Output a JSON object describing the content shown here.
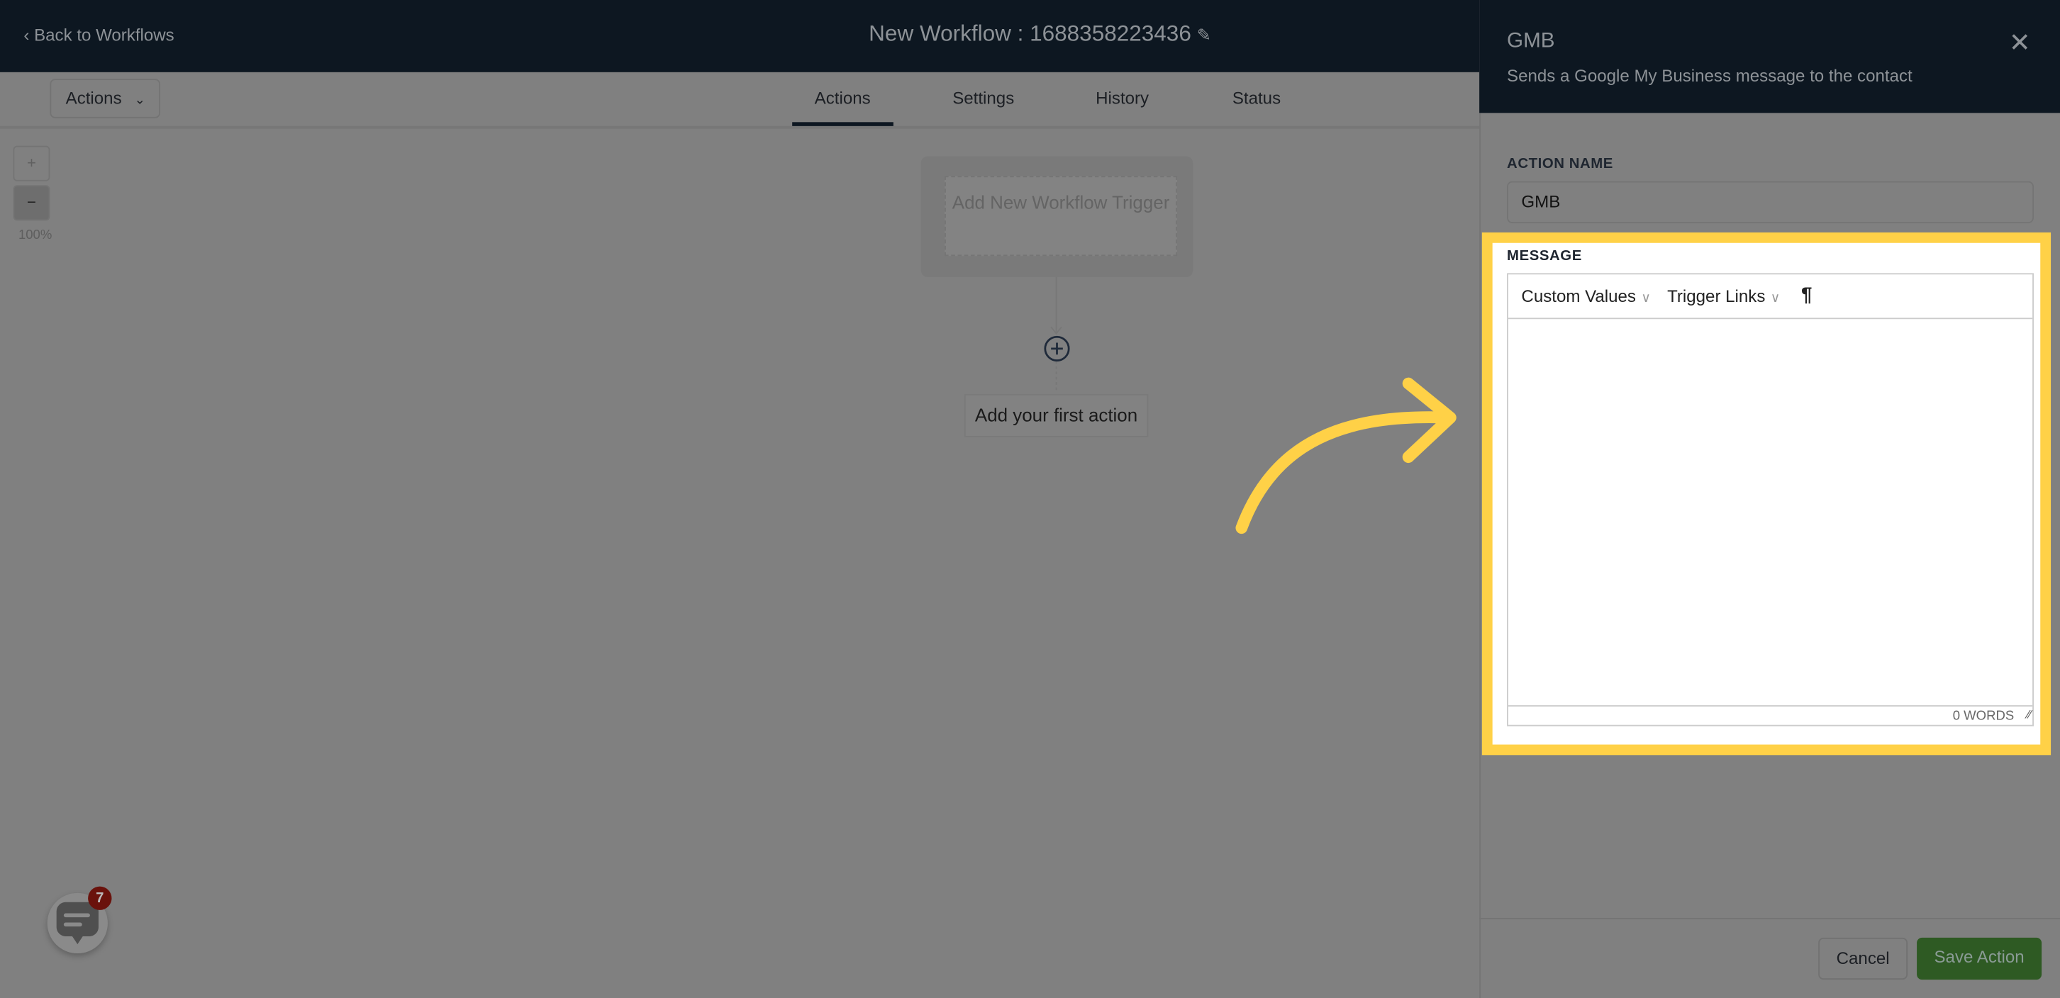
{
  "header": {
    "back_label": "Back to Workflows",
    "title": "New Workflow : 1688358223436",
    "edit_icon": "pencil-icon"
  },
  "toolbar": {
    "actions_dropdown": "Actions"
  },
  "tabs": [
    {
      "label": "Actions",
      "active": true
    },
    {
      "label": "Settings"
    },
    {
      "label": "History"
    },
    {
      "label": "Status"
    }
  ],
  "zoom": {
    "plus": "+",
    "minus": "−",
    "level": "100%"
  },
  "canvas": {
    "trigger_label": "Add New Workflow Trigger",
    "first_action_label": "Add your first action"
  },
  "panel": {
    "title": "GMB",
    "subtitle": "Sends a Google My Business message to the contact",
    "action_name_label": "ACTION NAME",
    "action_name_value": "GMB",
    "message_label": "MESSAGE",
    "editor_tools": [
      "Custom Values",
      "Trigger Links"
    ],
    "paragraph_icon": "¶",
    "word_count": "0 WORDS",
    "cancel_label": "Cancel",
    "save_label": "Save Action"
  },
  "chat_widget": {
    "badge_count": "7"
  },
  "colors": {
    "header_bg": "#0d1721",
    "highlight": "#ffd147",
    "save_button": "#2e5a23",
    "badge": "#6a120c",
    "overlay": "#808080"
  }
}
